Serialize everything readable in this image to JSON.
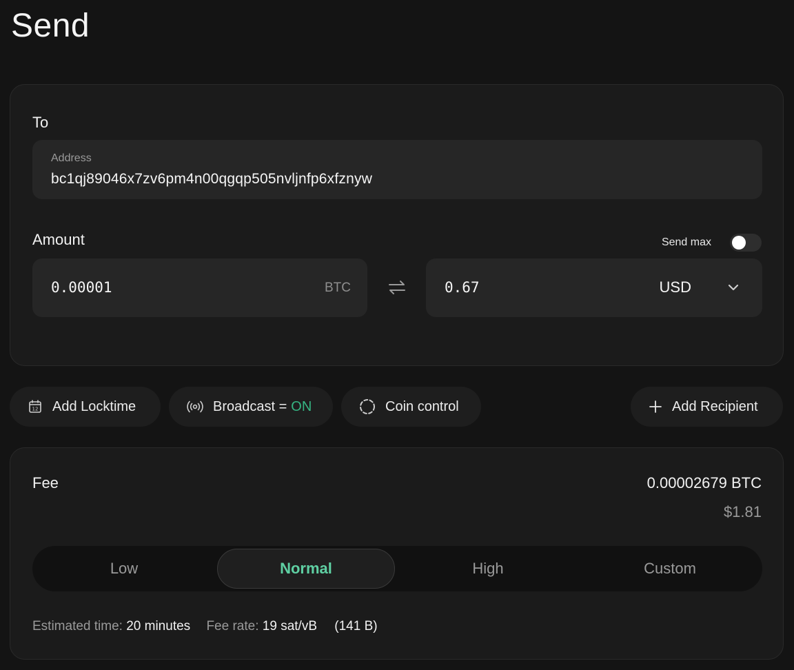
{
  "page": {
    "title": "Send"
  },
  "recipient": {
    "to_label": "To",
    "address_caption": "Address",
    "address_value": "bc1qj89046x7zv6pm4n00qgqp505nvljnfp6xfznyw"
  },
  "amount": {
    "label": "Amount",
    "send_max_label": "Send max",
    "send_max_enabled": false,
    "btc_value": "0.00001",
    "btc_unit": "BTC",
    "fiat_value": "0.67",
    "fiat_currency": "USD"
  },
  "actions": {
    "locktime_label": "Add Locktime",
    "broadcast_label": "Broadcast =",
    "broadcast_state": "ON",
    "coin_control_label": "Coin control",
    "add_recipient_label": "Add Recipient"
  },
  "fee": {
    "label": "Fee",
    "btc_amount": "0.00002679 BTC",
    "usd_amount": "$1.81",
    "options": [
      "Low",
      "Normal",
      "High",
      "Custom"
    ],
    "selected": "Normal",
    "estimated_time_label": "Estimated time:",
    "estimated_time_value": "20 minutes",
    "fee_rate_label": "Fee rate:",
    "fee_rate_value": "19 sat/vB",
    "size": "(141 B)"
  },
  "colors": {
    "background": "#141414",
    "card": "#1b1b1b",
    "field": "#262626",
    "accent_green": "#5fd0a3",
    "on_green": "#36b583"
  },
  "icons": {
    "locktime": "calendar-icon",
    "broadcast": "broadcast-icon",
    "coin_control": "dashed-circle-icon",
    "add_recipient": "plus-icon",
    "swap": "swap-arrows-icon",
    "currency_dropdown": "chevron-down-icon"
  }
}
